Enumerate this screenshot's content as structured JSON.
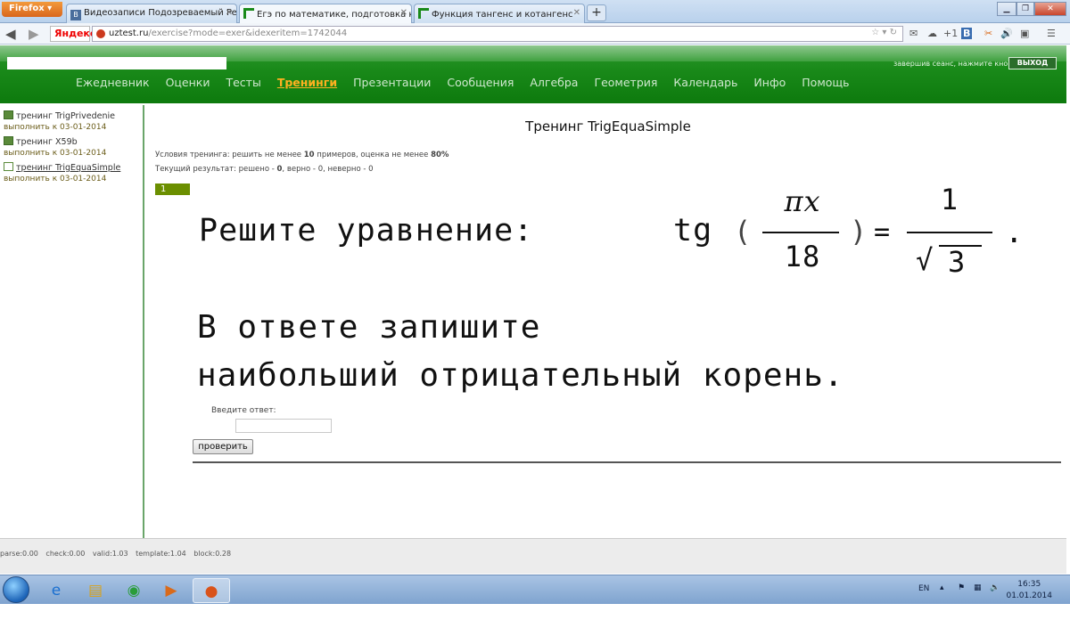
{
  "browser": {
    "app_menu": "Firefox",
    "tabs": [
      {
        "title": "Видеозаписи Подозреваемый Pers..."
      },
      {
        "title": "Егэ по математике, подготовка к те..."
      },
      {
        "title": "Функция тангенс и котангенс"
      }
    ],
    "url_host": "uztest.ru",
    "url_path": "/exercise?mode=exer&idexeritem=1742044",
    "search_engine": "Яндекс",
    "toolbar_extra": "+1"
  },
  "header": {
    "logout_hint": "завершив сеанс, нажмите кнопку",
    "logout_label": "ВЫХОД",
    "nav": [
      "Ежедневник",
      "Оценки",
      "Тесты",
      "Тренинги",
      "Презентации",
      "Сообщения",
      "Алгебра",
      "Геометрия",
      "Календарь",
      "Инфо",
      "Помощь"
    ],
    "active_nav": "Тренинги"
  },
  "sidebar": {
    "items": [
      {
        "title": "тренинг TrigPrivedenie",
        "due": "выполнить к 03-01-2014"
      },
      {
        "title": "тренинг X59b",
        "due": "выполнить к 03-01-2014"
      },
      {
        "title": "тренинг TrigEquaSimple",
        "due": "выполнить к 03-01-2014"
      }
    ]
  },
  "main": {
    "title": "Тренинг TrigEquaSimple",
    "conditions": {
      "prefix": "Условия тренинга: решить не менее ",
      "min_count": "10",
      "middle": " примеров, оценка не менее ",
      "min_score": "80%"
    },
    "result": {
      "prefix": "Текущий результат: решено - ",
      "solved": "0",
      "rest": ", верно - 0, неверно - 0"
    },
    "question_number": "1",
    "task": {
      "line1": "Решите уравнение:",
      "tg": "tg",
      "num": "πx",
      "den": "18",
      "rhs_num": "1",
      "rhs_den": "3",
      "line2": "В ответе запишите",
      "line3": "наибольший отрицательный корень."
    },
    "answer_label": "Введите ответ:",
    "answer_value": "",
    "check_button": "проверить"
  },
  "footer": {
    "timing": [
      "parse:0.00",
      "check:0.00",
      "valid:1.03",
      "template:1.04",
      "block:0.28"
    ]
  },
  "taskbar": {
    "lang": "EN",
    "time": "16:35",
    "date": "01.01.2014"
  },
  "colors": {
    "header_green": "#1a8a1a",
    "active_nav": "#ffb020",
    "due_text": "#6b5d1a",
    "question_badge": "#6b8f00"
  }
}
